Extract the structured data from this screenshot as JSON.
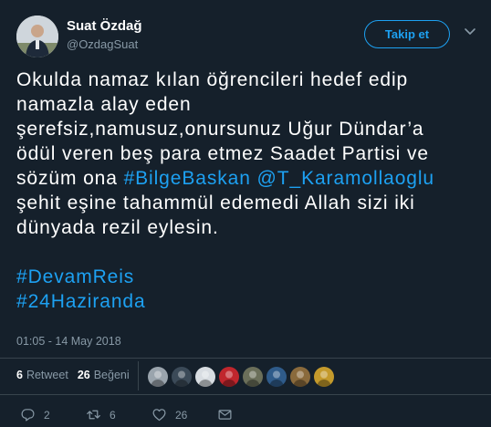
{
  "author": {
    "name": "Suat Özdağ",
    "handle": "@OzdagSuat"
  },
  "follow_button": {
    "label": "Takip et"
  },
  "tweet": {
    "lines": [
      [
        {
          "t": "Okulda namaz kılan öğrencileri hedef edip",
          "link": false
        }
      ],
      [
        {
          "t": "namazla alay eden",
          "link": false
        }
      ],
      [
        {
          "t": "şerefsiz,namusuz,onursunuz Uğur Dündar’a",
          "link": false
        }
      ],
      [
        {
          "t": "ödül veren beş para etmez Saadet Partisi ve",
          "link": false
        }
      ],
      [
        {
          "t": "sözüm ona ",
          "link": false
        },
        {
          "t": "#BilgeBaskan",
          "link": true
        },
        {
          "t": " ",
          "link": false
        },
        {
          "t": "@T_Karamollaoglu",
          "link": true
        }
      ],
      [
        {
          "t": "şehit eşine tahammül edemedi Allah sizi iki",
          "link": false
        }
      ],
      [
        {
          "t": "dünyada rezil eylesin.",
          "link": false
        }
      ],
      [
        {
          "t": "",
          "link": false
        }
      ],
      [
        {
          "t": "#DevamReis",
          "link": true
        }
      ],
      [
        {
          "t": "#24Haziranda",
          "link": true
        }
      ]
    ]
  },
  "timestamp": "01:05 - 14 May 2018",
  "stats": {
    "retweet_count": "6",
    "retweet_label": "Retweet",
    "like_count": "26",
    "like_label": "Beğeni"
  },
  "likers": [
    {
      "name": "liker-avatar-1",
      "color": "#9aa4ad"
    },
    {
      "name": "liker-avatar-2",
      "color": "#3b4a58"
    },
    {
      "name": "liker-avatar-3",
      "color": "#d8dde2"
    },
    {
      "name": "liker-avatar-4",
      "color": "#c0262d"
    },
    {
      "name": "liker-avatar-5",
      "color": "#6b6f5a"
    },
    {
      "name": "liker-avatar-6",
      "color": "#2f5b8a"
    },
    {
      "name": "liker-avatar-7",
      "color": "#8a6a3c"
    },
    {
      "name": "liker-avatar-8",
      "color": "#c49a2c"
    }
  ],
  "actions": {
    "reply_count": "2",
    "retweet_count": "6",
    "like_count": "26"
  },
  "colors": {
    "background": "#15202b",
    "accent": "#1da1f2",
    "muted": "#8899a6",
    "divider": "#38444d"
  }
}
